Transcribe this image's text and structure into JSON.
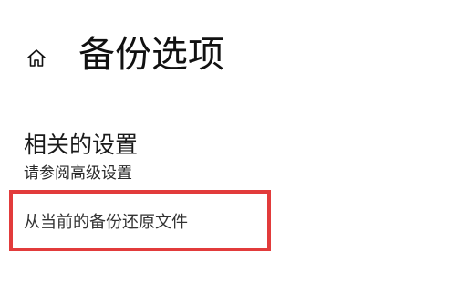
{
  "header": {
    "home_icon": "home-icon",
    "title": "备份选项"
  },
  "related_settings": {
    "title": "相关的设置",
    "advanced_link": "请参阅高级设置",
    "restore_link": "从当前的备份还原文件"
  },
  "colors": {
    "highlight_border": "#e23b3b",
    "text_primary": "#111111"
  }
}
